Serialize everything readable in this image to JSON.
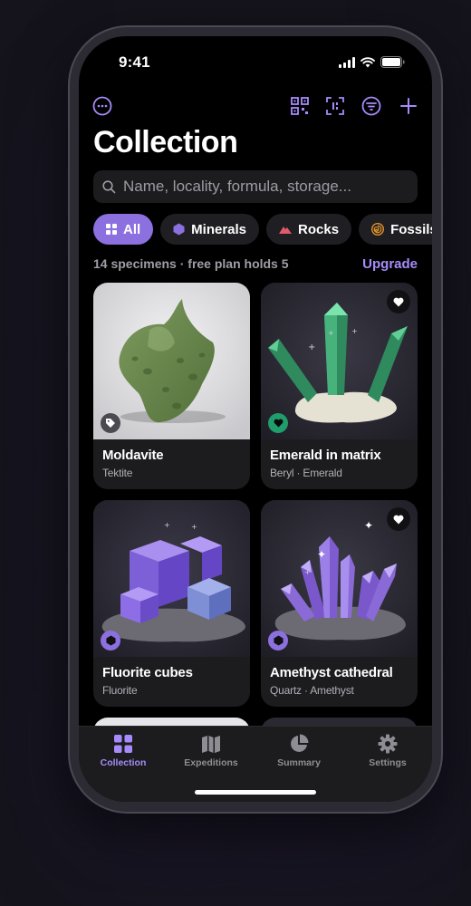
{
  "status": {
    "time": "9:41"
  },
  "header": {
    "title": "Collection",
    "icons": [
      "more-icon",
      "qr-code-icon",
      "scan-icon",
      "filter-icon",
      "add-icon"
    ]
  },
  "search": {
    "placeholder": "Name, locality, formula, storage..."
  },
  "filters": [
    {
      "label": "All",
      "icon": "grid-icon",
      "active": true
    },
    {
      "label": "Minerals",
      "icon": "hexagon-icon"
    },
    {
      "label": "Rocks",
      "icon": "mountain-icon"
    },
    {
      "label": "Fossils",
      "icon": "spiral-icon"
    }
  ],
  "meta": {
    "count_text": "14 specimens · free plan holds 5",
    "upgrade_label": "Upgrade"
  },
  "specimens": [
    {
      "name": "Moldavite",
      "subtitle": "Tektite",
      "badge": "tag-icon",
      "favorite": false
    },
    {
      "name": "Emerald in matrix",
      "subtitle": "Beryl · Emerald",
      "badge": "heart-icon",
      "favorite": true
    },
    {
      "name": "Fluorite cubes",
      "subtitle": "Fluorite",
      "badge": "hexagon-icon",
      "favorite": false
    },
    {
      "name": "Amethyst cathedral",
      "subtitle": "Quartz · Amethyst",
      "badge": "hexagon-icon",
      "favorite": true
    }
  ],
  "tabs": [
    {
      "label": "Collection",
      "icon": "grid-icon",
      "active": true
    },
    {
      "label": "Expeditions",
      "icon": "map-icon"
    },
    {
      "label": "Summary",
      "icon": "pie-chart-icon"
    },
    {
      "label": "Settings",
      "icon": "gear-icon"
    }
  ],
  "colors": {
    "accent": "#8d70e0",
    "accent_text": "#a78bfa",
    "background": "#000000",
    "card": "#1c1c1f"
  }
}
